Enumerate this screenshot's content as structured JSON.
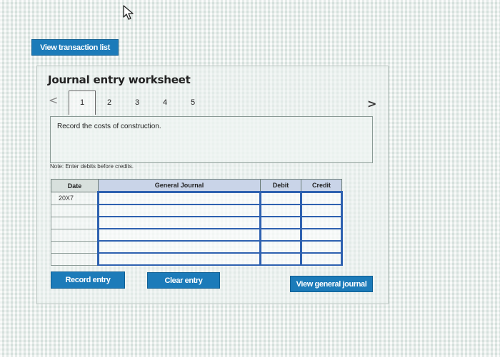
{
  "top_button": {
    "label": "View transaction list"
  },
  "worksheet": {
    "title": "Journal entry worksheet",
    "pager": {
      "prev_icon": "chevron-left-icon",
      "next_icon": "chevron-right-icon",
      "tabs": [
        "1",
        "2",
        "3",
        "4",
        "5"
      ],
      "active_tab": "1"
    },
    "instruction": "Record the costs of construction.",
    "note": "Note: Enter debits before credits."
  },
  "table": {
    "headers": {
      "date": "Date",
      "journal": "General Journal",
      "debit": "Debit",
      "credit": "Credit"
    },
    "rows": [
      {
        "date": "20X7",
        "journal": "",
        "debit": "",
        "credit": ""
      },
      {
        "date": "",
        "journal": "",
        "debit": "",
        "credit": ""
      },
      {
        "date": "",
        "journal": "",
        "debit": "",
        "credit": ""
      },
      {
        "date": "",
        "journal": "",
        "debit": "",
        "credit": ""
      },
      {
        "date": "",
        "journal": "",
        "debit": "",
        "credit": ""
      },
      {
        "date": "",
        "journal": "",
        "debit": "",
        "credit": ""
      }
    ]
  },
  "buttons": {
    "record": "Record entry",
    "clear": "Clear entry",
    "view_journal": "View general journal"
  },
  "colors": {
    "button_bg": "#1c7bb9",
    "table_accent": "#2e61b0"
  }
}
